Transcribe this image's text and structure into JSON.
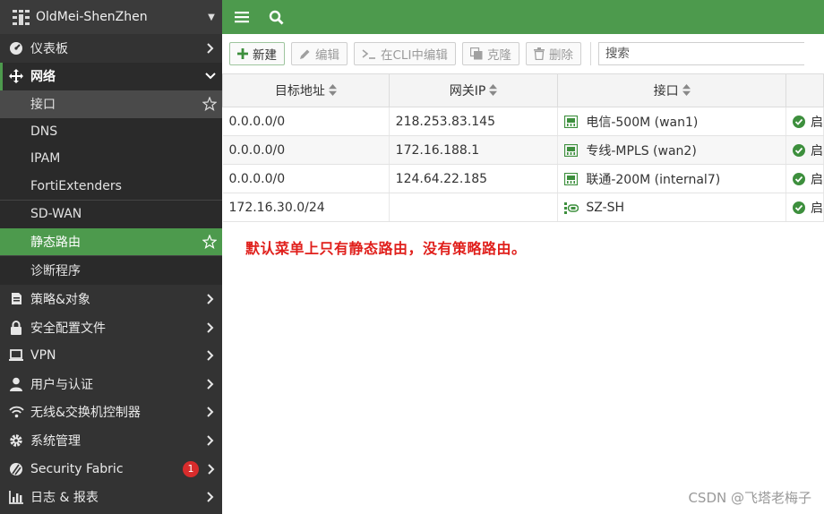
{
  "sidebar": {
    "hostname": "OldMei-ShenZhen",
    "items": [
      {
        "label": "仪表板"
      },
      {
        "label": "网络"
      },
      {
        "label": "策略&对象"
      },
      {
        "label": "安全配置文件"
      },
      {
        "label": "VPN"
      },
      {
        "label": "用户与认证"
      },
      {
        "label": "无线&交换机控制器"
      },
      {
        "label": "系统管理"
      },
      {
        "label": "Security Fabric",
        "badge": "1"
      },
      {
        "label": "日志 & 报表"
      }
    ],
    "network_sub": [
      {
        "label": "接口"
      },
      {
        "label": "DNS"
      },
      {
        "label": "IPAM"
      },
      {
        "label": "FortiExtenders"
      },
      {
        "label": "SD-WAN"
      },
      {
        "label": "静态路由"
      },
      {
        "label": "诊断程序"
      }
    ]
  },
  "toolbar": {
    "new_label": "新建",
    "edit_label": "编辑",
    "cli_edit_label": "在CLI中编辑",
    "clone_label": "克隆",
    "delete_label": "删除",
    "search_placeholder": "搜索"
  },
  "table": {
    "columns": [
      "目标地址",
      "网关IP",
      "接口"
    ],
    "rows": [
      {
        "dest": "0.0.0.0/0",
        "gateway": "218.253.83.145",
        "iface": "电信-500M (wan1)",
        "iface_type": "physical",
        "status": "启"
      },
      {
        "dest": "0.0.0.0/0",
        "gateway": "172.16.188.1",
        "iface": "专线-MPLS (wan2)",
        "iface_type": "physical",
        "status": "启"
      },
      {
        "dest": "0.0.0.0/0",
        "gateway": "124.64.22.185",
        "iface": "联通-200M (internal7)",
        "iface_type": "physical",
        "status": "启"
      },
      {
        "dest": "172.16.30.0/24",
        "gateway": "",
        "iface": "SZ-SH",
        "iface_type": "tunnel",
        "status": "启"
      }
    ]
  },
  "annotation": "默认菜单上只有静态路由，没有策略路由。",
  "watermark": "CSDN @飞塔老梅子",
  "colors": {
    "accent": "#4d9a4d",
    "sidebar": "#333333",
    "note": "#e0201c",
    "badge": "#d82c2c"
  }
}
